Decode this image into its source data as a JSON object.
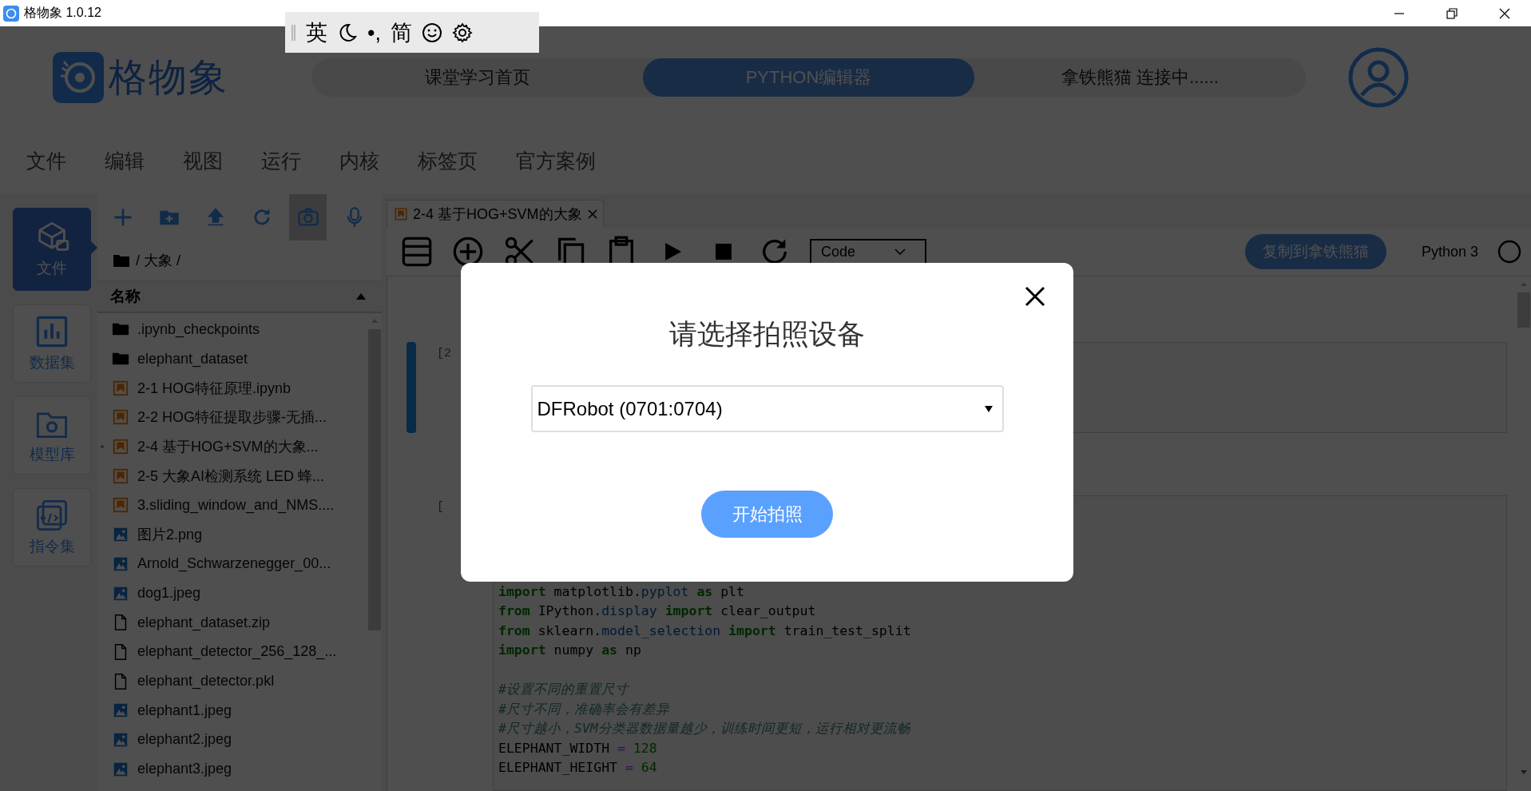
{
  "title_bar": {
    "title": "格物象 1.0.12"
  },
  "ime_toolbar": {
    "labels": [
      "英",
      "•,",
      "简"
    ]
  },
  "header": {
    "logo_text": "格物象",
    "nav": [
      {
        "label": "课堂学习首页",
        "selected": false
      },
      {
        "label": "PYTHON编辑器",
        "selected": true
      },
      {
        "label": "拿铁熊猫 连接中......",
        "selected": false
      }
    ]
  },
  "menu": [
    "文件",
    "编辑",
    "视图",
    "运行",
    "内核",
    "标签页",
    "官方案例"
  ],
  "sidebar": {
    "items": [
      {
        "label": "文件",
        "selected": true
      },
      {
        "label": "数据集",
        "selected": false
      },
      {
        "label": "模型库",
        "selected": false
      },
      {
        "label": "指令集",
        "selected": false
      }
    ]
  },
  "file_panel": {
    "toolbar": [
      {
        "selected": false
      },
      {
        "selected": false
      },
      {
        "selected": false
      },
      {
        "selected": false
      },
      {
        "selected": true
      },
      {
        "selected": false
      }
    ],
    "path": "/ 大象 /",
    "column": "名称",
    "files": [
      {
        "name": ".ipynb_checkpoints",
        "kind": "folder",
        "running": false
      },
      {
        "name": "elephant_dataset",
        "kind": "folder",
        "running": false
      },
      {
        "name": "2-1 HOG特征原理.ipynb",
        "kind": "notebook",
        "running": false
      },
      {
        "name": "2-2 HOG特征提取步骤-无插...",
        "kind": "notebook",
        "running": false
      },
      {
        "name": "2-4 基于HOG+SVM的大象...",
        "kind": "notebook",
        "running": true
      },
      {
        "name": "2-5 大象AI检测系统 LED 蜂...",
        "kind": "notebook",
        "running": false
      },
      {
        "name": "3.sliding_window_and_NMS....",
        "kind": "notebook",
        "running": false
      },
      {
        "name": "图片2.png",
        "kind": "image",
        "running": false
      },
      {
        "name": "Arnold_Schwarzenegger_00...",
        "kind": "image",
        "running": false
      },
      {
        "name": "dog1.jpeg",
        "kind": "image",
        "running": false
      },
      {
        "name": "elephant_dataset.zip",
        "kind": "file",
        "running": false
      },
      {
        "name": "elephant_detector_256_128_...",
        "kind": "file",
        "running": false
      },
      {
        "name": "elephant_detector.pkl",
        "kind": "file",
        "running": false
      },
      {
        "name": "elephant1.jpeg",
        "kind": "image",
        "running": false
      },
      {
        "name": "elephant2.jpeg",
        "kind": "image",
        "running": false
      },
      {
        "name": "elephant3.jpeg",
        "kind": "image",
        "running": false
      }
    ]
  },
  "notebook": {
    "tab": {
      "title": "2-4 基于HOG+SVM的大象"
    },
    "cell_type": "Code",
    "copy_button": "复制到拿铁熊猫",
    "kernel": "Python 3",
    "kernel_busy": false,
    "cells": [
      {
        "prompt": "[2",
        "selected": true
      },
      {
        "prompt": "[",
        "selected": false,
        "lines": [
          {
            "kind": "code",
            "tokens": [
              {
                "kind": "keyword",
                "text": "import"
              },
              {
                "kind": "plain",
                "text": " matplotlib."
              },
              {
                "kind": "module",
                "text": "pyplot "
              },
              {
                "kind": "keyword",
                "text": "as"
              },
              {
                "kind": "plain",
                "text": " plt"
              }
            ]
          },
          {
            "kind": "code",
            "tokens": [
              {
                "kind": "keyword",
                "text": "from"
              },
              {
                "kind": "plain",
                "text": " IPython."
              },
              {
                "kind": "module",
                "text": "display "
              },
              {
                "kind": "keyword",
                "text": "import"
              },
              {
                "kind": "plain",
                "text": " clear_output"
              }
            ]
          },
          {
            "kind": "code",
            "tokens": [
              {
                "kind": "keyword",
                "text": "from"
              },
              {
                "kind": "plain",
                "text": " sklearn."
              },
              {
                "kind": "module",
                "text": "model_selection "
              },
              {
                "kind": "keyword",
                "text": "import"
              },
              {
                "kind": "plain",
                "text": " train_test_split"
              }
            ]
          },
          {
            "kind": "code",
            "tokens": [
              {
                "kind": "keyword",
                "text": "import"
              },
              {
                "kind": "plain",
                "text": " numpy "
              },
              {
                "kind": "keyword",
                "text": "as"
              },
              {
                "kind": "plain",
                "text": " np"
              }
            ]
          },
          {
            "kind": "blank"
          },
          {
            "kind": "code",
            "tokens": [
              {
                "kind": "comment",
                "text": "#设置不同的重置尺寸"
              }
            ]
          },
          {
            "kind": "code",
            "tokens": [
              {
                "kind": "comment",
                "text": "#尺寸不同，准确率会有差异"
              }
            ]
          },
          {
            "kind": "code",
            "tokens": [
              {
                "kind": "comment",
                "text": "#尺寸越小，SVM分类器数据量越少，训练时间更短，运行相对更流畅"
              }
            ]
          },
          {
            "kind": "code",
            "tokens": [
              {
                "kind": "plain",
                "text": "ELEPHANT_WIDTH "
              },
              {
                "kind": "operator",
                "text": "= "
              },
              {
                "kind": "number",
                "text": "128"
              }
            ]
          },
          {
            "kind": "code",
            "tokens": [
              {
                "kind": "plain",
                "text": "ELEPHANT_HEIGHT "
              },
              {
                "kind": "operator",
                "text": "= "
              },
              {
                "kind": "number",
                "text": "64"
              }
            ]
          }
        ]
      }
    ]
  },
  "dialog": {
    "title": "请选择拍照设备",
    "device": "DFRobot (0701:0704)",
    "button": "开始拍照"
  }
}
